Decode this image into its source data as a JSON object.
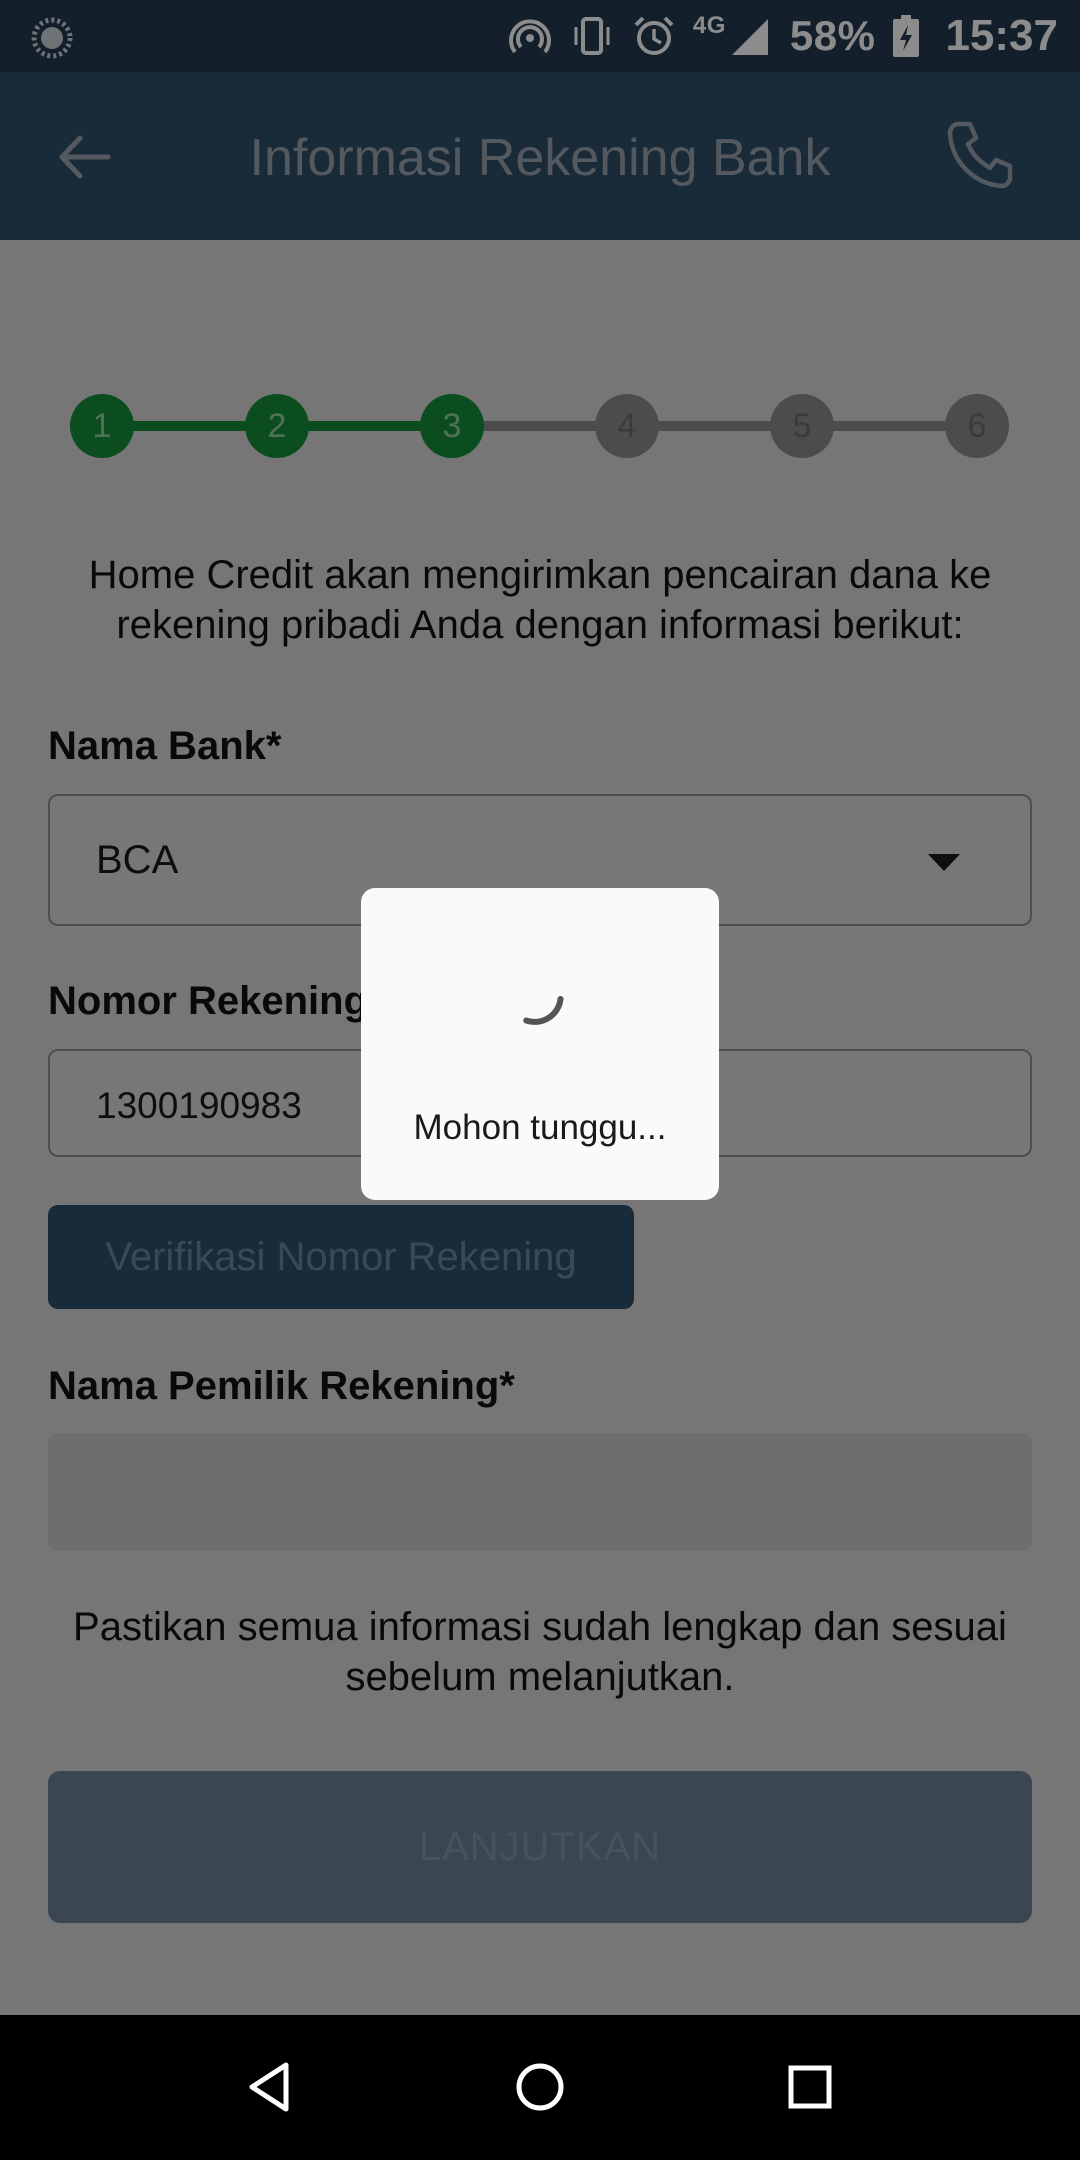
{
  "status_bar": {
    "battery_percent": "58%",
    "time": "15:37",
    "network": "4G",
    "icons": [
      "loading-indicator-icon",
      "hotspot-icon",
      "vibrate-icon",
      "alarm-icon",
      "signal-icon",
      "battery-charging-icon"
    ]
  },
  "app_bar": {
    "title": "Informasi Rekening Bank",
    "back_icon": "arrow-left-icon",
    "call_icon": "phone-icon"
  },
  "stepper": {
    "steps": [
      {
        "label": "1",
        "state": "done"
      },
      {
        "label": "2",
        "state": "done"
      },
      {
        "label": "3",
        "state": "done"
      },
      {
        "label": "4",
        "state": "todo"
      },
      {
        "label": "5",
        "state": "todo"
      },
      {
        "label": "6",
        "state": "todo"
      }
    ],
    "done_color": "#168c3b",
    "todo_color": "#8a8a8a"
  },
  "form": {
    "intro": "Home Credit akan mengirimkan pencairan dana ke rekening pribadi Anda dengan informasi berikut:",
    "bank_label": "Nama Bank*",
    "bank_value": "BCA",
    "account_label": "Nomor Rekening Bank*",
    "account_value": "1300190983",
    "verify_label": "Verifikasi Nomor Rekening",
    "owner_label": "Nama Pemilik Rekening*",
    "owner_value": "",
    "note": "Pastikan semua informasi sudah lengkap dan sesuai sebelum melanjutkan.",
    "next_label": "LANJUTKAN"
  },
  "dialog": {
    "message": "Mohon tunggu..."
  },
  "colors": {
    "primary": "#2f4d67",
    "accent_green": "#168c3b"
  }
}
